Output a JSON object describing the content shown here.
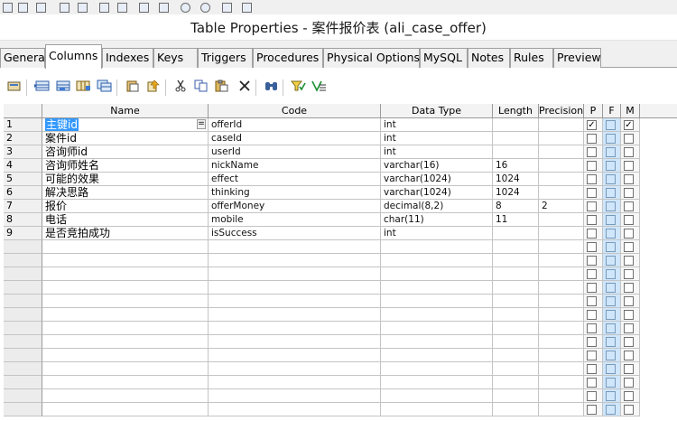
{
  "window": {
    "title": "Table Properties - 案件报价表 (ali_case_offer)"
  },
  "tabs": [
    {
      "label": "General"
    },
    {
      "label": "Columns",
      "active": true
    },
    {
      "label": "Indexes"
    },
    {
      "label": "Keys"
    },
    {
      "label": "Triggers"
    },
    {
      "label": "Procedures"
    },
    {
      "label": "Physical Options"
    },
    {
      "label": "MySQL"
    },
    {
      "label": "Notes"
    },
    {
      "label": "Rules"
    },
    {
      "label": "Preview"
    }
  ],
  "toolbar": {
    "buttons": [
      {
        "name": "properties-icon"
      },
      {
        "name": "insert-row-icon"
      },
      {
        "name": "add-row-icon"
      },
      {
        "name": "add-columns-icon"
      },
      {
        "name": "copy-rows-icon"
      },
      {
        "name": "paste-rows-icon"
      },
      {
        "name": "move-up-icon"
      },
      {
        "name": "cut-icon"
      },
      {
        "name": "copy-icon"
      },
      {
        "name": "paste-icon"
      },
      {
        "name": "delete-icon"
      },
      {
        "name": "find-icon"
      },
      {
        "name": "filter-icon"
      },
      {
        "name": "customize-columns-icon"
      }
    ]
  },
  "grid": {
    "headers": {
      "name": "Name",
      "code": "Code",
      "data_type": "Data Type",
      "length": "Length",
      "precision": "Precision",
      "p": "P",
      "f": "F",
      "m": "M"
    },
    "ellipsis": "=",
    "checkmark": "✓",
    "empty_rows": 13,
    "rows": [
      {
        "num": "1",
        "name": "主键id",
        "code": "offerId",
        "data_type": "int",
        "length": "",
        "precision": "",
        "p": true,
        "f": false,
        "m": true,
        "selected": true
      },
      {
        "num": "2",
        "name": "案件id",
        "code": "caseId",
        "data_type": "int",
        "length": "",
        "precision": "",
        "p": false,
        "f": false,
        "m": false
      },
      {
        "num": "3",
        "name": "咨询师id",
        "code": "userId",
        "data_type": "int",
        "length": "",
        "precision": "",
        "p": false,
        "f": false,
        "m": false
      },
      {
        "num": "4",
        "name": "咨询师姓名",
        "code": "nickName",
        "data_type": "varchar(16)",
        "length": "16",
        "precision": "",
        "p": false,
        "f": false,
        "m": false
      },
      {
        "num": "5",
        "name": "可能的效果",
        "code": "effect",
        "data_type": "varchar(1024)",
        "length": "1024",
        "precision": "",
        "p": false,
        "f": false,
        "m": false
      },
      {
        "num": "6",
        "name": "解决思路",
        "code": "thinking",
        "data_type": "varchar(1024)",
        "length": "1024",
        "precision": "",
        "p": false,
        "f": false,
        "m": false
      },
      {
        "num": "7",
        "name": "报价",
        "code": "offerMoney",
        "data_type": "decimal(8,2)",
        "length": "8",
        "precision": "2",
        "p": false,
        "f": false,
        "m": false
      },
      {
        "num": "8",
        "name": "电话",
        "code": "mobile",
        "data_type": "char(11)",
        "length": "11",
        "precision": "",
        "p": false,
        "f": false,
        "m": false
      },
      {
        "num": "9",
        "name": "是否竞拍成功",
        "code": "isSuccess",
        "data_type": "int",
        "length": "",
        "precision": "",
        "p": false,
        "f": false,
        "m": false
      }
    ]
  }
}
